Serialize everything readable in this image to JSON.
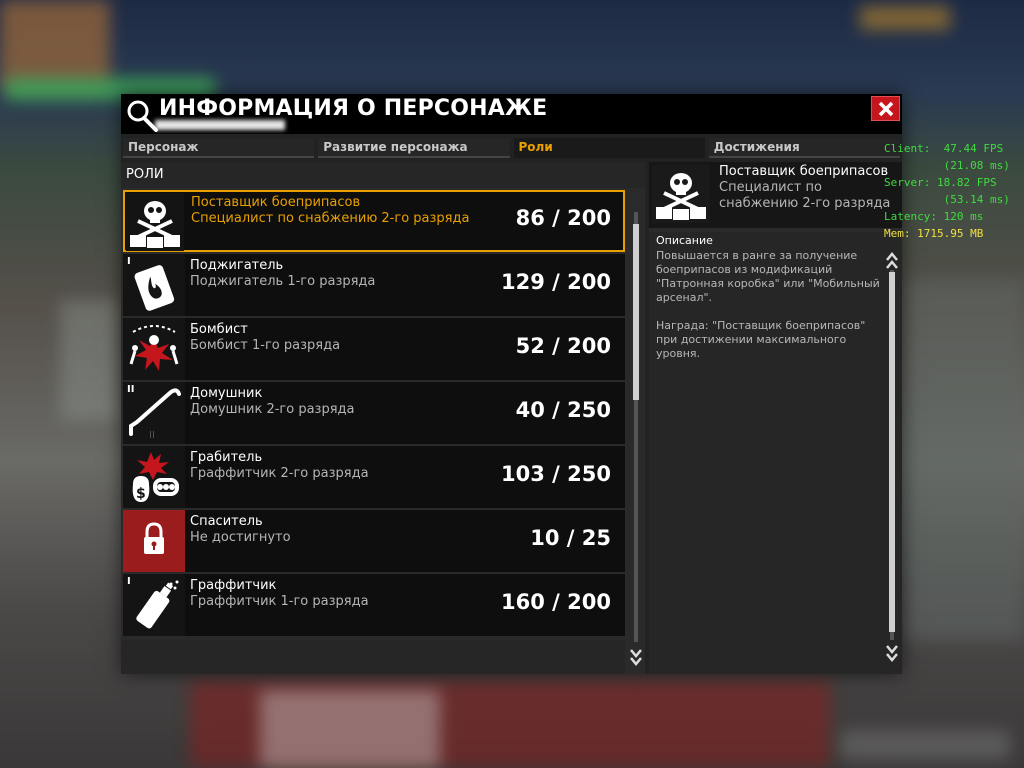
{
  "window": {
    "title": "ИНФОРМАЦИЯ О ПЕРСОНАЖЕ",
    "tabs": [
      {
        "label": "Персонаж"
      },
      {
        "label": "Развитие персонажа"
      },
      {
        "label": "Роли"
      },
      {
        "label": "Достижения"
      }
    ],
    "active_tab": "Роли"
  },
  "roles_panel": {
    "header": "РОЛИ",
    "items": [
      {
        "name": "Поставщик боеприпасов",
        "rank": "Специалист по снабжению 2-го разряда",
        "progress": "86 / 200",
        "pips": "",
        "icon": "skull-crates-icon"
      },
      {
        "name": "Поджигатель",
        "rank": "Поджигатель 1-го разряда",
        "progress": "129 / 200",
        "pips": "I",
        "icon": "fire-card-icon"
      },
      {
        "name": "Бомбист",
        "rank": "Бомбист 1-го разряда",
        "progress": "52 / 200",
        "pips": "",
        "icon": "explosion-icon"
      },
      {
        "name": "Домушник",
        "rank": "Домушник 2-го разряда",
        "progress": "40 / 250",
        "pips": "II",
        "icon": "crowbar-icon"
      },
      {
        "name": "Грабитель",
        "rank": "Граффитчик 2-го разряда",
        "progress": "103 / 250",
        "pips": "",
        "icon": "money-bag-icon"
      },
      {
        "name": "Спаситель",
        "rank": "Не достигнуто",
        "progress": "10 / 25",
        "pips": "",
        "icon": "lock-icon"
      },
      {
        "name": "Граффитчик",
        "rank": "Граффитчик 1-го разряда",
        "progress": "160 / 200",
        "pips": "I",
        "icon": "spray-can-icon"
      }
    ]
  },
  "detail": {
    "name": "Поставщик боеприпасов",
    "rank": "Специалист по снабжению 2-го разряда",
    "desc_label": "Описание",
    "description": "Повышается в ранге за получение боеприпасов из модификаций \"Патронная коробка\" или \"Мобильный арсенал\".\n\nНаграда: \"Поставщик боеприпасов\" при достижении максимального уровня."
  },
  "stats": {
    "client_label": "Client:",
    "client_fps": "47.44 FPS",
    "client_ms": "(21.08 ms)",
    "server_label": "Server:",
    "server_fps": "18.82 FPS",
    "server_ms": "(53.14 ms)",
    "latency": "Latency: 120 ms",
    "mem": "Mem: 1715.95 MB"
  },
  "colors": {
    "accent": "#e8a000",
    "close": "#c4161c",
    "stats_green": "#3fdc3f",
    "stats_yellow": "#f0e040"
  }
}
